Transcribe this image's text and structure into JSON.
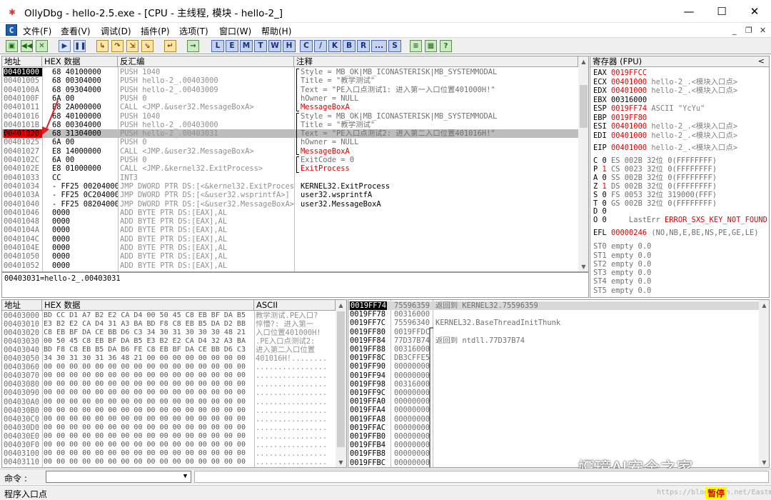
{
  "window": {
    "title": "OllyDbg - hello-2.5.exe - [CPU - 主线程, 模块 - hello-2_]",
    "minimize": "—",
    "maximize": "☐",
    "close": "✕"
  },
  "menu": {
    "items": [
      "文件(F)",
      "查看(V)",
      "调试(D)",
      "插件(P)",
      "选项(T)",
      "窗口(W)",
      "帮助(H)"
    ],
    "mdi_minimize": "_",
    "mdi_restore": "❐",
    "mdi_close": "✕"
  },
  "toolbar": {
    "buttons": [
      "open-icon",
      "restart-icon",
      "close-icon",
      "run-icon",
      "pause-icon",
      "step-into-icon",
      "step-over-icon",
      "trace-into-icon",
      "trace-over-icon",
      "execute-till-return-icon",
      "go-to-icon"
    ],
    "letters": [
      "L",
      "E",
      "M",
      "T",
      "W",
      "H",
      "C",
      "/",
      "K",
      "B",
      "R",
      "...",
      "S"
    ],
    "extra": [
      "list-icon",
      "grid-icon",
      "help-icon"
    ]
  },
  "disasm": {
    "headers": {
      "addr": "地址",
      "hex": "HEX 数据",
      "asm": "反汇编",
      "comment": "注释"
    },
    "rows": [
      {
        "addr": "00401000",
        "hex": "68 40100000",
        "asm": "PUSH 1040",
        "comment": "Style = MB_OK|MB_ICONASTERISK|MB_SYSTEMMODAL",
        "addr_style": "eip",
        "comment_color": "gray"
      },
      {
        "addr": "00401005",
        "hex": "68 00304000",
        "asm": "PUSH hello-2_.00403000",
        "comment": "Title = \"教学测试\"",
        "comment_color": "gray"
      },
      {
        "addr": "0040100A",
        "hex": "68 09304000",
        "asm": "PUSH hello-2_.00403009",
        "comment": "Text = \"PE入口点测试1: 进入第一入口位置401000H!\"",
        "comment_color": "gray"
      },
      {
        "addr": "0040100F",
        "hex": "6A 00",
        "asm": "PUSH 0",
        "comment": "hOwner = NULL",
        "comment_color": "gray"
      },
      {
        "addr": "00401011",
        "hex": "E8 2A000000",
        "asm": "CALL <JMP.&user32.MessageBoxA>",
        "comment": "MessageBoxA",
        "comment_color": "red"
      },
      {
        "addr": "00401016",
        "hex": "68 40100000",
        "asm": "PUSH 1040",
        "comment": "Style = MB_OK|MB_ICONASTERISK|MB_SYSTEMMODAL",
        "comment_color": "gray"
      },
      {
        "addr": "0040101B",
        "hex": "68 00304000",
        "asm": "PUSH hello-2_.00403000",
        "comment": "Title = \"教学测试\"",
        "comment_color": "gray"
      },
      {
        "addr": "00401020",
        "hex": "68 31304000",
        "asm": "PUSH hello-2_.00403031",
        "comment": "Text = \"PE入口点测试2: 进入第二入口位置401016H!\"",
        "addr_style": "bp",
        "selected": true,
        "comment_color": "gray"
      },
      {
        "addr": "00401025",
        "hex": "6A 00",
        "asm": "PUSH 0",
        "comment": "hOwner = NULL",
        "comment_color": "gray"
      },
      {
        "addr": "00401027",
        "hex": "E8 14000000",
        "asm": "CALL <JMP.&user32.MessageBoxA>",
        "comment": "MessageBoxA",
        "comment_color": "red"
      },
      {
        "addr": "0040102C",
        "hex": "6A 00",
        "asm": "PUSH 0",
        "comment": "ExitCode = 0",
        "comment_color": "gray"
      },
      {
        "addr": "0040102E",
        "hex": "E8 01000000",
        "asm": "CALL <JMP.&kernel32.ExitProcess>",
        "comment": "ExitProcess",
        "comment_color": "red"
      },
      {
        "addr": "00401033",
        "hex": "CC",
        "asm": "INT3",
        "comment": ""
      },
      {
        "addr": "00401034",
        "hex": "- FF25 00204000",
        "asm": "JMP DWORD PTR DS:[<&kernel32.ExitProcess>]",
        "comment": "KERNEL32.ExitProcess",
        "comment_color": "black"
      },
      {
        "addr": "0040103A",
        "hex": "- FF25 0C204000",
        "asm": "JMP DWORD PTR DS:[<&user32.wsprintfA>]",
        "comment": "user32.wsprintfA",
        "comment_color": "black"
      },
      {
        "addr": "00401040",
        "hex": "- FF25 08204000",
        "asm": "JMP DWORD PTR DS:[<&user32.MessageBoxA>]",
        "comment": "user32.MessageBoxA",
        "comment_color": "black"
      },
      {
        "addr": "00401046",
        "hex": "0000",
        "asm": "ADD BYTE PTR DS:[EAX],AL",
        "comment": ""
      },
      {
        "addr": "00401048",
        "hex": "0000",
        "asm": "ADD BYTE PTR DS:[EAX],AL",
        "comment": ""
      },
      {
        "addr": "0040104A",
        "hex": "0000",
        "asm": "ADD BYTE PTR DS:[EAX],AL",
        "comment": ""
      },
      {
        "addr": "0040104C",
        "hex": "0000",
        "asm": "ADD BYTE PTR DS:[EAX],AL",
        "comment": ""
      },
      {
        "addr": "0040104E",
        "hex": "0000",
        "asm": "ADD BYTE PTR DS:[EAX],AL",
        "comment": ""
      },
      {
        "addr": "00401050",
        "hex": "0000",
        "asm": "ADD BYTE PTR DS:[EAX],AL",
        "comment": ""
      },
      {
        "addr": "00401052",
        "hex": "0000",
        "asm": "ADD BYTE PTR DS:[EAX],AL",
        "comment": ""
      }
    ],
    "info_line": "00403031=hello-2_.00403031"
  },
  "registers": {
    "title": "寄存器 (FPU)",
    "collapse": "<",
    "gp": [
      {
        "name": "EAX",
        "value": "0019FFCC",
        "note": "",
        "changed": true
      },
      {
        "name": "ECX",
        "value": "00401000",
        "note": "hello-2_.<模块入口点>",
        "changed": true
      },
      {
        "name": "EDX",
        "value": "00401000",
        "note": "hello-2_.<模块入口点>",
        "changed": true
      },
      {
        "name": "EBX",
        "value": "00316000",
        "note": "",
        "changed": false
      },
      {
        "name": "ESP",
        "value": "0019FF74",
        "note": "ASCII \"YcYu\"",
        "changed": true
      },
      {
        "name": "EBP",
        "value": "0019FF80",
        "note": "",
        "changed": true
      },
      {
        "name": "ESI",
        "value": "00401000",
        "note": "hello-2_.<模块入口点>",
        "changed": true
      },
      {
        "name": "EDI",
        "value": "00401000",
        "note": "hello-2_.<模块入口点>",
        "changed": true
      }
    ],
    "eip": {
      "name": "EIP",
      "value": "00401000",
      "note": "hello-2_.<模块入口点>"
    },
    "flags": [
      {
        "f": "C",
        "v": "0",
        "seg": "ES",
        "sel": "002B",
        "bits": "32位",
        "rng": "0(FFFFFFFF)"
      },
      {
        "f": "P",
        "v": "1",
        "seg": "CS",
        "sel": "0023",
        "bits": "32位",
        "rng": "0(FFFFFFFF)",
        "changed": true
      },
      {
        "f": "A",
        "v": "0",
        "seg": "SS",
        "sel": "002B",
        "bits": "32位",
        "rng": "0(FFFFFFFF)"
      },
      {
        "f": "Z",
        "v": "1",
        "seg": "DS",
        "sel": "002B",
        "bits": "32位",
        "rng": "0(FFFFFFFF)",
        "changed": true
      },
      {
        "f": "S",
        "v": "0",
        "seg": "FS",
        "sel": "0053",
        "bits": "32位",
        "rng": "319000(FFF)"
      },
      {
        "f": "T",
        "v": "0",
        "seg": "GS",
        "sel": "002B",
        "bits": "32位",
        "rng": "0(FFFFFFFF)"
      },
      {
        "f": "D",
        "v": "0",
        "seg": "",
        "sel": "",
        "bits": "",
        "rng": ""
      },
      {
        "f": "O",
        "v": "0",
        "seg": "",
        "sel": "",
        "bits": "",
        "rng": ""
      }
    ],
    "lasterr_label": "LastErr",
    "lasterr_value": "ERROR_SXS_KEY_NOT_FOUND (00",
    "efl_label": "EFL",
    "efl_value": "00000246",
    "efl_note": "(NO,NB,E,BE,NS,PE,GE,LE)",
    "fpu": [
      "ST0 empty 0.0",
      "ST1 empty 0.0",
      "ST2 empty 0.0",
      "ST3 empty 0.0",
      "ST4 empty 0.0",
      "ST5 empty 0.0"
    ]
  },
  "dump": {
    "headers": {
      "addr": "地址",
      "hex": "HEX 数据",
      "ascii": "ASCII"
    },
    "rows": [
      {
        "addr": "00403000",
        "hex": "BD CC D1 A7 B2 E2 CA D4 00 50 45 C8 EB BF DA B5",
        "ascii": "教学测试.PE入口?"
      },
      {
        "addr": "00403010",
        "hex": "E3 B2 E2 CA D4 31 A3 BA BD F8 C8 EB B5 DA D2 BB",
        "ascii": "悴懵?: 进入第一"
      },
      {
        "addr": "00403020",
        "hex": "C8 EB BF DA CE BB D6 C3 34 30 31 30 30 30 48 21",
        "ascii": "入口位置401000H!"
      },
      {
        "addr": "00403030",
        "hex": "00 50 45 C8 EB BF DA B5 E3 B2 E2 CA D4 32 A3 BA",
        "ascii": ".PE入口点测试2:"
      },
      {
        "addr": "00403040",
        "hex": "BD F8 C8 EB B5 DA B6 FE C8 EB BF DA CE BB D6 C3",
        "ascii": "进入第二入口位置"
      },
      {
        "addr": "00403050",
        "hex": "34 30 31 30 31 36 48 21 00 00 00 00 00 00 00 00",
        "ascii": "401016H!........"
      },
      {
        "addr": "00403060",
        "hex": "00 00 00 00 00 00 00 00 00 00 00 00 00 00 00 00",
        "ascii": "................"
      },
      {
        "addr": "00403070",
        "hex": "00 00 00 00 00 00 00 00 00 00 00 00 00 00 00 00",
        "ascii": "................"
      },
      {
        "addr": "00403080",
        "hex": "00 00 00 00 00 00 00 00 00 00 00 00 00 00 00 00",
        "ascii": "................"
      },
      {
        "addr": "00403090",
        "hex": "00 00 00 00 00 00 00 00 00 00 00 00 00 00 00 00",
        "ascii": "................"
      },
      {
        "addr": "004030A0",
        "hex": "00 00 00 00 00 00 00 00 00 00 00 00 00 00 00 00",
        "ascii": "................"
      },
      {
        "addr": "004030B0",
        "hex": "00 00 00 00 00 00 00 00 00 00 00 00 00 00 00 00",
        "ascii": "................"
      },
      {
        "addr": "004030C0",
        "hex": "00 00 00 00 00 00 00 00 00 00 00 00 00 00 00 00",
        "ascii": "................"
      },
      {
        "addr": "004030D0",
        "hex": "00 00 00 00 00 00 00 00 00 00 00 00 00 00 00 00",
        "ascii": "................"
      },
      {
        "addr": "004030E0",
        "hex": "00 00 00 00 00 00 00 00 00 00 00 00 00 00 00 00",
        "ascii": "................"
      },
      {
        "addr": "004030F0",
        "hex": "00 00 00 00 00 00 00 00 00 00 00 00 00 00 00 00",
        "ascii": "................"
      },
      {
        "addr": "00403100",
        "hex": "00 00 00 00 00 00 00 00 00 00 00 00 00 00 00 00",
        "ascii": "................"
      },
      {
        "addr": "00403110",
        "hex": "00 00 00 00 00 00 00 00 00 00 00 00 00 00 00 00",
        "ascii": "................"
      }
    ]
  },
  "stack": {
    "rows": [
      {
        "addr": "0019FF74",
        "value": "75596359",
        "comment": "返回到 KERNEL32.75596359",
        "selected": true
      },
      {
        "addr": "0019FF78",
        "value": "00316000",
        "comment": ""
      },
      {
        "addr": "0019FF7C",
        "value": "75596340",
        "comment": "KERNEL32.BaseThreadInitThunk"
      },
      {
        "addr": "0019FF80",
        "value": "0019FFDC",
        "comment": ""
      },
      {
        "addr": "0019FF84",
        "value": "77D37B74",
        "comment": "返回到 ntdll.77D37B74"
      },
      {
        "addr": "0019FF88",
        "value": "00316000",
        "comment": ""
      },
      {
        "addr": "0019FF8C",
        "value": "DB3CFFE5",
        "comment": ""
      },
      {
        "addr": "0019FF90",
        "value": "00000000",
        "comment": ""
      },
      {
        "addr": "0019FF94",
        "value": "00000000",
        "comment": ""
      },
      {
        "addr": "0019FF98",
        "value": "00316000",
        "comment": ""
      },
      {
        "addr": "0019FF9C",
        "value": "00000000",
        "comment": ""
      },
      {
        "addr": "0019FFA0",
        "value": "00000000",
        "comment": ""
      },
      {
        "addr": "0019FFA4",
        "value": "00000000",
        "comment": ""
      },
      {
        "addr": "0019FFA8",
        "value": "00000000",
        "comment": ""
      },
      {
        "addr": "0019FFAC",
        "value": "00000000",
        "comment": ""
      },
      {
        "addr": "0019FFB0",
        "value": "00000000",
        "comment": ""
      },
      {
        "addr": "0019FFB4",
        "value": "00000000",
        "comment": ""
      },
      {
        "addr": "0019FFB8",
        "value": "00000000",
        "comment": ""
      },
      {
        "addr": "0019FFBC",
        "value": "00000000",
        "comment": ""
      }
    ]
  },
  "command": {
    "label": "命令 :",
    "value": ""
  },
  "status": {
    "text": "程序入口点",
    "state": "暂停"
  },
  "watermark": {
    "text": "娜璋AI安全之家",
    "url": "https://blog.csdn.net/Eastmount"
  }
}
